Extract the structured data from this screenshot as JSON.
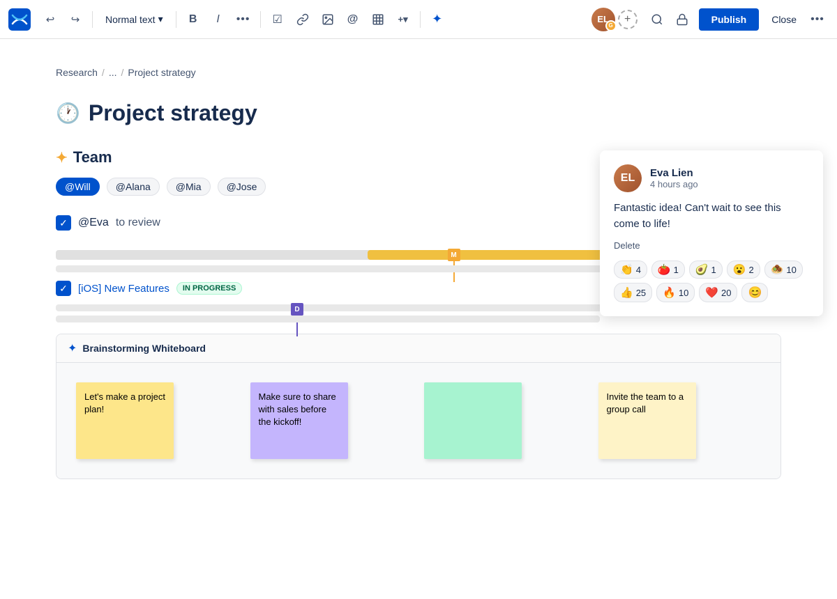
{
  "toolbar": {
    "logo_label": "Confluence",
    "undo_label": "↩",
    "redo_label": "↪",
    "text_style": "Normal text",
    "bold_label": "B",
    "italic_label": "I",
    "more_label": "•••",
    "task_label": "☑",
    "link_label": "🔗",
    "image_label": "🖼",
    "mention_label": "@",
    "table_label": "⊞",
    "insert_label": "+▾",
    "ai_label": "✦",
    "search_label": "🔍",
    "lock_label": "🔒",
    "publish_label": "Publish",
    "close_label": "Close",
    "more2_label": "•••"
  },
  "breadcrumb": {
    "root": "Research",
    "sep1": "/",
    "ellipsis": "...",
    "sep2": "/",
    "current": "Project strategy"
  },
  "page": {
    "title": "Project strategy",
    "title_icon": "🕐"
  },
  "team_section": {
    "heading": "Team",
    "sparkle": "✦",
    "members": [
      {
        "label": "@Will",
        "active": true
      },
      {
        "label": "@Alana",
        "active": false
      },
      {
        "label": "@Mia",
        "active": false
      },
      {
        "label": "@Jose",
        "active": false
      }
    ]
  },
  "task": {
    "assignee": "@Eva",
    "label": "to review"
  },
  "ios_task": {
    "name": "[iOS] New Features",
    "status": "IN PROGRESS"
  },
  "gantt": {
    "bar_left": "43%",
    "bar_width": "35%",
    "marker_m_left": "54%",
    "marker_m_label": "M",
    "marker_d_left": "38%",
    "marker_d_label": "D"
  },
  "whiteboard": {
    "title": "Brainstorming Whiteboard",
    "notes": [
      {
        "text": "Let's make a project plan!",
        "color": "yellow"
      },
      {
        "text": "Make sure to share with sales before the kickoff!",
        "color": "purple"
      },
      {
        "text": "",
        "color": "green"
      },
      {
        "text": "Invite the team to a group call",
        "color": "yellow2"
      }
    ]
  },
  "comment": {
    "author": "Eva Lien",
    "time": "4 hours ago",
    "text": "Fantastic idea! Can't wait to see this come to life!",
    "delete_label": "Delete",
    "reactions": [
      {
        "emoji": "👏",
        "count": "4"
      },
      {
        "emoji": "🍅",
        "count": "1"
      },
      {
        "emoji": "🥑",
        "count": "1"
      },
      {
        "emoji": "😮",
        "count": "2"
      },
      {
        "emoji": "🧆",
        "count": "10"
      },
      {
        "emoji": "👍",
        "count": "25"
      },
      {
        "emoji": "🔥",
        "count": "10"
      },
      {
        "emoji": "❤️",
        "count": "20"
      }
    ],
    "add_label": "😊"
  }
}
